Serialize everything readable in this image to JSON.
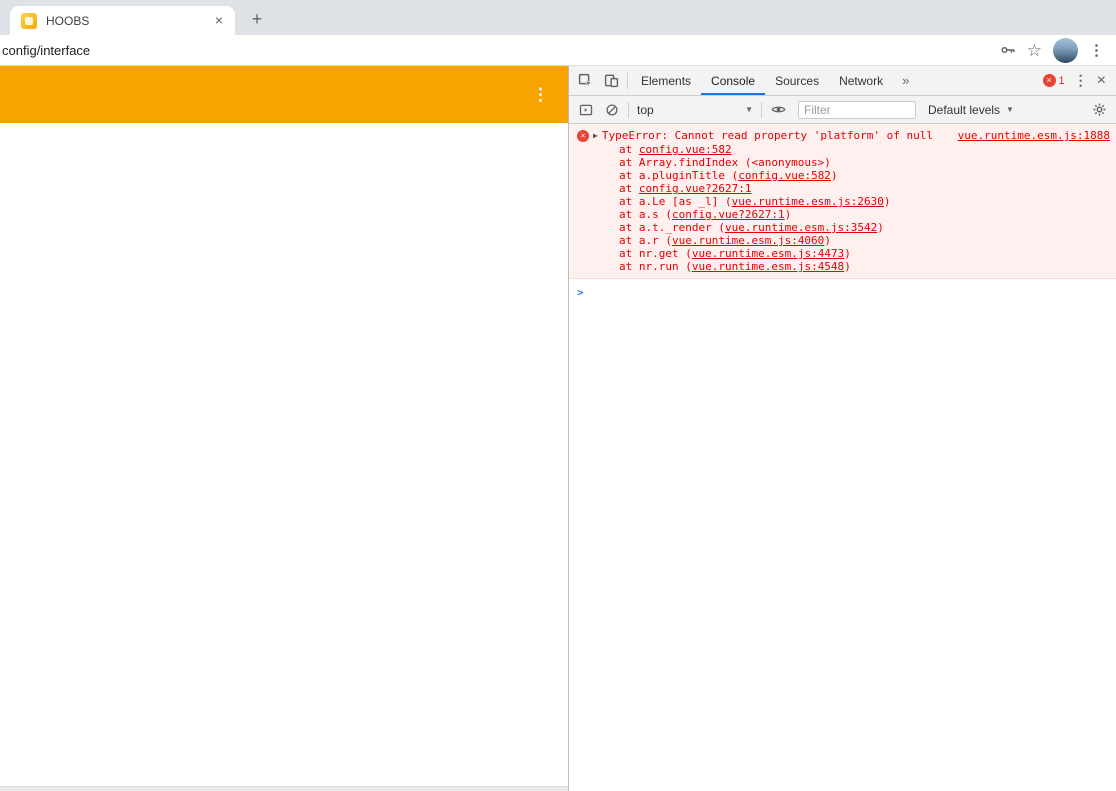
{
  "colors": {
    "accent_orange": "#f7a400",
    "error_red": "#e60000",
    "error_bg": "#fff0f0",
    "error_border": "#ffd6d6",
    "active_tab_underline": "#1a73e8",
    "prompt_blue": "#367cf1",
    "badge_red": "#ea4335"
  },
  "browser": {
    "tab_title": "HOOBS",
    "address": "config/interface"
  },
  "icons": {
    "close": "×",
    "new_tab": "+",
    "kebab": "⋮",
    "star": "☆",
    "more_tabs": "»",
    "caret_right": "▶",
    "dropdown_arrow": "▼",
    "prompt_chevron": ">",
    "error_x": "×"
  },
  "devtools": {
    "tabs": [
      "Elements",
      "Console",
      "Sources",
      "Network"
    ],
    "active_tab": "Console",
    "error_count": "1",
    "toolbar": {
      "context": "top",
      "filter_placeholder": "Filter",
      "levels_label": "Default levels"
    },
    "console": {
      "error": {
        "message": "TypeError: Cannot read property 'platform' of null",
        "location": "vue.runtime.esm.js:1888",
        "stack": [
          {
            "pre": "at ",
            "link": "config.vue:582",
            "post": ""
          },
          {
            "pre": "at Array.findIndex (<anonymous>)",
            "link": "",
            "post": ""
          },
          {
            "pre": "at a.pluginTitle (",
            "link": "config.vue:582",
            "post": ")"
          },
          {
            "pre": "at ",
            "link": "config.vue?2627:1",
            "post": ""
          },
          {
            "pre": "at a.Le [as _l] (",
            "link": "vue.runtime.esm.js:2630",
            "post": ")"
          },
          {
            "pre": "at a.s (",
            "link": "config.vue?2627:1",
            "post": ")"
          },
          {
            "pre": "at a.t._render (",
            "link": "vue.runtime.esm.js:3542",
            "post": ")"
          },
          {
            "pre": "at a.r (",
            "link": "vue.runtime.esm.js:4060",
            "post": ")"
          },
          {
            "pre": "at nr.get (",
            "link": "vue.runtime.esm.js:4473",
            "post": ")"
          },
          {
            "pre": "at nr.run (",
            "link": "vue.runtime.esm.js:4548",
            "post": ")"
          }
        ]
      }
    }
  }
}
